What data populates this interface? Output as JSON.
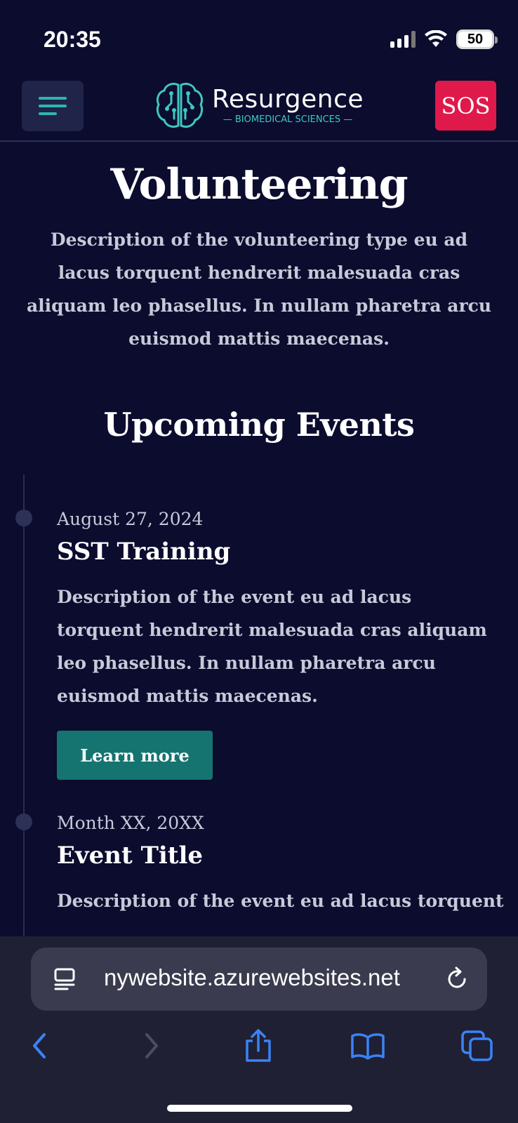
{
  "status_bar": {
    "time": "20:35",
    "battery": "50"
  },
  "header": {
    "menu_icon": "hamburger-icon",
    "logo": {
      "name": "Resurgence",
      "subtitle": "BIOMEDICAL SCIENCES",
      "icon": "brain-circuit-icon"
    },
    "sos_label": "SOS",
    "colors": {
      "sos": "#e0194b",
      "accent": "#2fb6b0",
      "background": "#0b0c2e"
    }
  },
  "main": {
    "title": "Volunteering",
    "description": "Description of the volunteering type eu ad lacus torquent hendrerit malesuada cras aliquam leo phasellus. In nullam pharetra arcu euismod mattis maecenas.",
    "events_title": "Upcoming Events",
    "events": [
      {
        "date": "August 27, 2024",
        "title": "SST Training",
        "description": "Description of the event eu ad lacus torquent hendrerit malesuada cras aliquam leo phasellus. In nullam pharetra arcu euismod mattis maecenas.",
        "button_label": "Learn more"
      },
      {
        "date": "Month XX, 20XX",
        "title": "Event Title",
        "description": "Description of the event eu ad lacus torquent"
      }
    ],
    "button_color": "#157470"
  },
  "browser": {
    "url": "nywebsite.azurewebsites.net",
    "toolbar": [
      "back-icon",
      "forward-icon",
      "share-icon",
      "bookmarks-icon",
      "tabs-icon"
    ],
    "accent": "#3b82f6"
  }
}
